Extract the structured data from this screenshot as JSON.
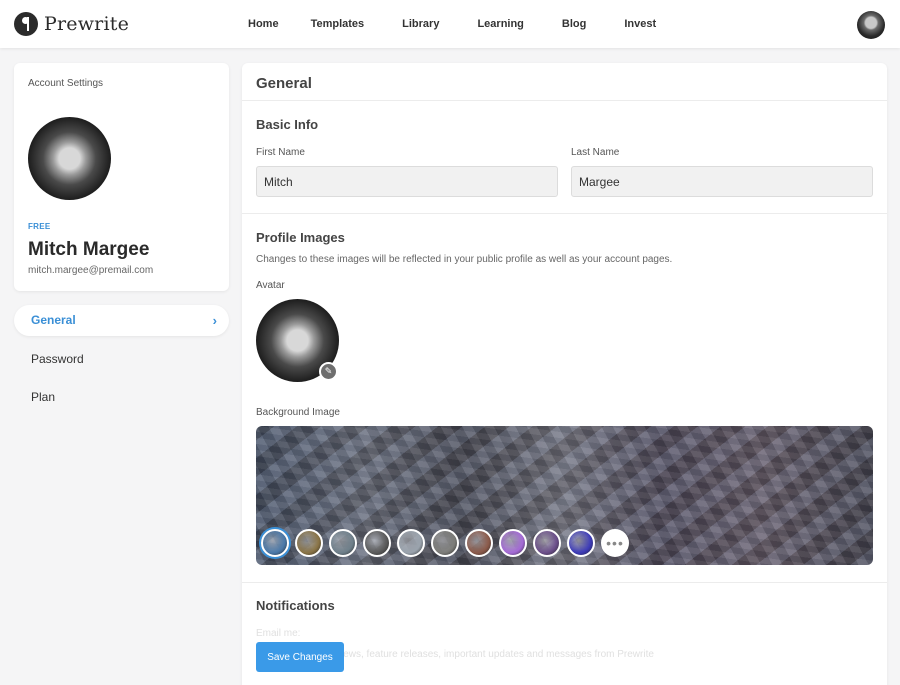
{
  "brand": {
    "name": "Prewrite"
  },
  "nav": [
    {
      "label": "Home"
    },
    {
      "label": "Templates"
    },
    {
      "label": "Library"
    },
    {
      "label": "Learning"
    },
    {
      "label": "Blog"
    },
    {
      "label": "Invest"
    }
  ],
  "sidebar": {
    "heading": "Account Settings",
    "plan": "FREE",
    "name": "Mitch Margee",
    "email": "mitch.margee@premail.com",
    "menu": [
      {
        "label": "General",
        "active": true
      },
      {
        "label": "Password"
      },
      {
        "label": "Plan"
      }
    ]
  },
  "main": {
    "title": "General",
    "basic_info": {
      "title": "Basic Info",
      "first_name_label": "First Name",
      "first_name_value": "Mitch",
      "last_name_label": "Last Name",
      "last_name_value": "Margee"
    },
    "profile_images": {
      "title": "Profile Images",
      "help": "Changes to these images will be reflected in your public profile as well as your account pages.",
      "avatar_label": "Avatar",
      "background_label": "Background Image",
      "thumbnails": [
        {
          "color": "#4a78a8",
          "selected": true
        },
        {
          "color": "#8a7446"
        },
        {
          "color": "#6e7f8a"
        },
        {
          "color": "#5a5a5a"
        },
        {
          "color": "#9aa3ad"
        },
        {
          "color": "#7c7c78"
        },
        {
          "color": "#8b5a4a"
        },
        {
          "color": "#a46ad6"
        },
        {
          "color": "#6b4e8a"
        },
        {
          "color": "#3d3bb8"
        }
      ]
    },
    "notifications": {
      "title": "Notifications",
      "faded_line_1": "Email me:",
      "faded_line_2": "News, feature releases, important updates and messages from Prewrite"
    },
    "save_label": "Save Changes"
  },
  "colors": {
    "accent": "#3a8fd6",
    "button": "#3a9ae8"
  }
}
